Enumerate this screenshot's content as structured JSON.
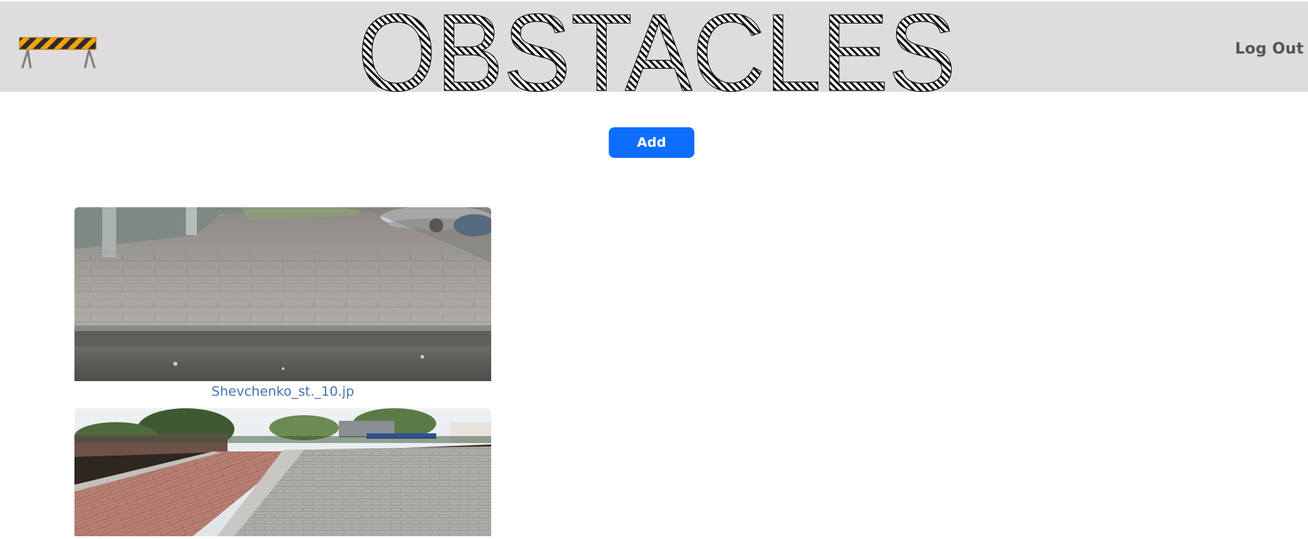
{
  "header": {
    "brand_title": "OBSTACLES",
    "logo_icon": "road-barrier-icon",
    "logout_label": "Log Out",
    "background_color": "#dedcdc"
  },
  "main": {
    "add_label": "Add",
    "add_color": "#0d6efd",
    "obstacles": [
      {
        "caption": "Shevchenko_st._10.jp",
        "photo": "sidewalk-curb-photo"
      },
      {
        "caption": "",
        "photo": "paved-path-photo"
      }
    ]
  }
}
